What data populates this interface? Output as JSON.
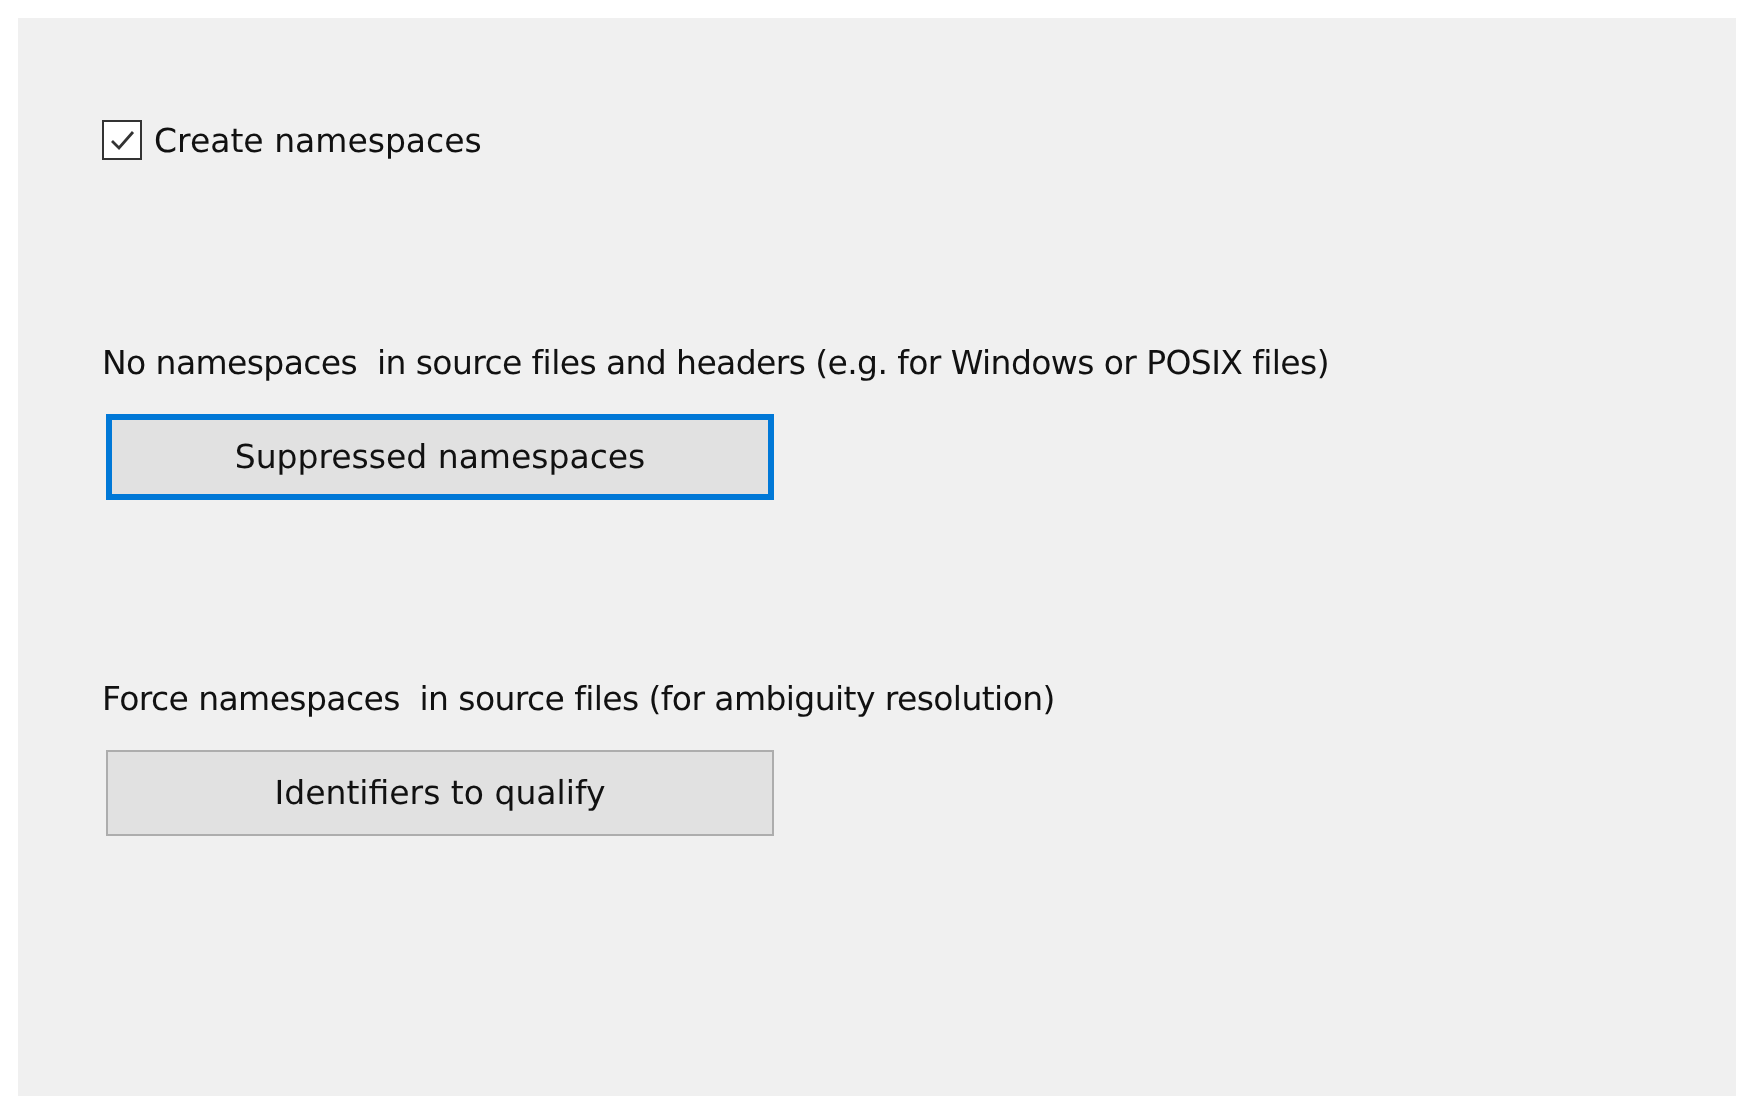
{
  "checkbox": {
    "label": "Create namespaces",
    "checked": true
  },
  "sections": [
    {
      "description": "No namespaces  in source files and headers (e.g. for Windows or POSIX files)",
      "button": {
        "label": "Suppressed namespaces",
        "focused": true
      }
    },
    {
      "description": "Force namespaces  in source files (for ambiguity resolution)",
      "button": {
        "label": "Identifiers to qualify",
        "focused": false
      }
    }
  ]
}
